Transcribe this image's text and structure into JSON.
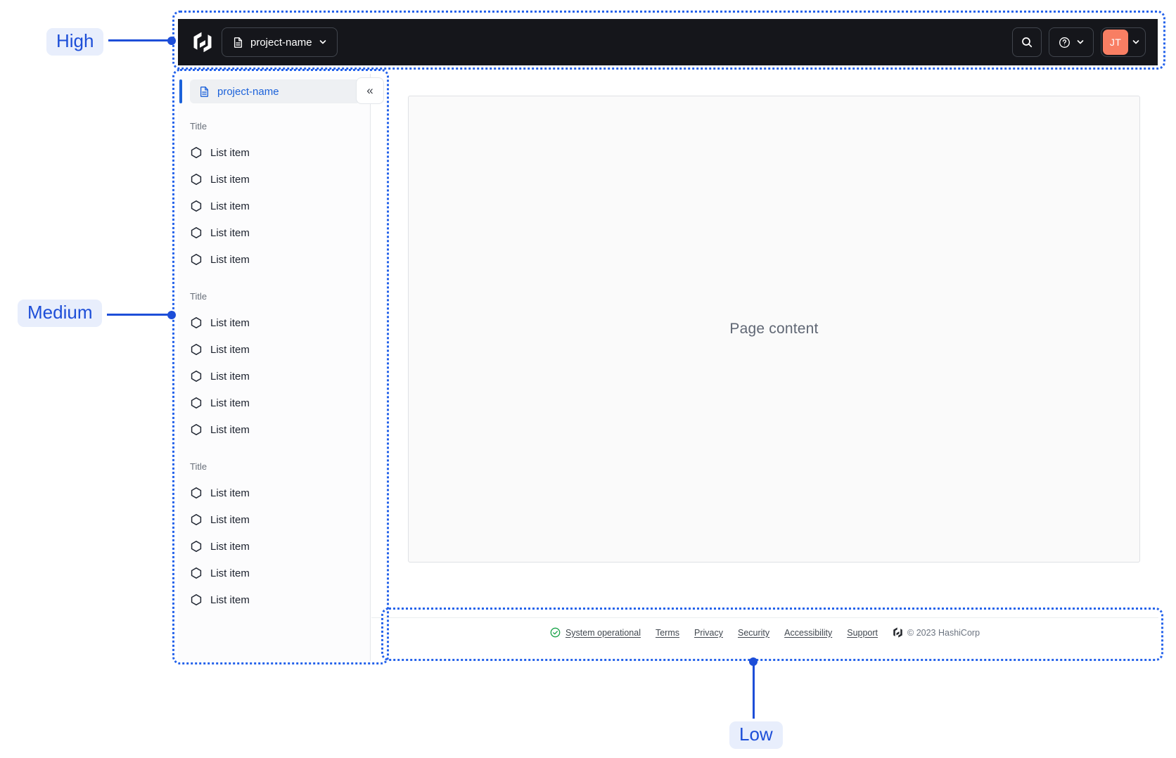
{
  "annotations": {
    "high_label": "High",
    "medium_label": "Medium",
    "low_label": "Low"
  },
  "navbar": {
    "project_switcher_label": "project-name",
    "avatar_initials": "JT"
  },
  "sidebar": {
    "project_label": "project-name",
    "collapse_glyph": "«",
    "sections": [
      {
        "title": "Title",
        "items": [
          "List item",
          "List item",
          "List item",
          "List item",
          "List item"
        ]
      },
      {
        "title": "Title",
        "items": [
          "List item",
          "List item",
          "List item",
          "List item",
          "List item"
        ]
      },
      {
        "title": "Title",
        "items": [
          "List item",
          "List item",
          "List item",
          "List item",
          "List item"
        ]
      }
    ]
  },
  "main": {
    "placeholder": "Page content"
  },
  "footer": {
    "status_label": "System operational",
    "links": [
      "Terms",
      "Privacy",
      "Security",
      "Accessibility",
      "Support"
    ],
    "copyright": "© 2023 HashiCorp"
  },
  "colors": {
    "annotation_blue": "#1d4ed8",
    "dotted_outline_blue": "#2563eb",
    "sidebar_accent_blue": "#1c62da",
    "avatar_orange": "#f87e63",
    "status_green": "#18a348",
    "navbar_bg": "#15161b"
  }
}
